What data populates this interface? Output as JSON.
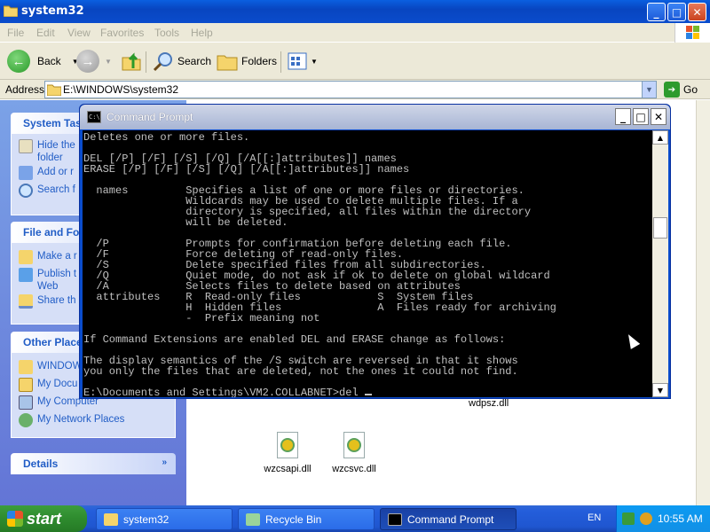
{
  "window": {
    "title": "system32",
    "minimize": "_",
    "maximize": "□",
    "close": "✕"
  },
  "menu": [
    "File",
    "Edit",
    "View",
    "Favorites",
    "Tools",
    "Help"
  ],
  "toolbar": {
    "back_label": "Back",
    "search_label": "Search",
    "folders_label": "Folders"
  },
  "address": {
    "label": "Address",
    "value": "E:\\WINDOWS\\system32",
    "go_label": "Go"
  },
  "left_pane": {
    "system_tasks": {
      "title": "System Tas",
      "items": [
        "Hide the\nfolder",
        "Add or r",
        "Search f"
      ]
    },
    "file_folder": {
      "title": "File and Fol",
      "items": [
        "Make a r",
        "Publish t\nWeb",
        "Share th"
      ]
    },
    "other_places": {
      "title": "Other Place",
      "items": [
        "WINDOW",
        "My Docu",
        "My Computer",
        "My Network Places"
      ]
    },
    "details": {
      "title": "Details"
    }
  },
  "files": [
    {
      "name": "wzcsapi.dll"
    },
    {
      "name": "wzcsvc.dll"
    }
  ],
  "partial_file": "wdpsz.dll",
  "cmd": {
    "title": "Command Prompt",
    "icon_text": "C:\\",
    "lines": [
      "Deletes one or more files.",
      "",
      "DEL [/P] [/F] [/S] [/Q] [/A[[:]attributes]] names",
      "ERASE [/P] [/F] [/S] [/Q] [/A[[:]attributes]] names",
      "",
      "  names         Specifies a list of one or more files or directories.",
      "                Wildcards may be used to delete multiple files. If a",
      "                directory is specified, all files within the directory",
      "                will be deleted.",
      "",
      "  /P            Prompts for confirmation before deleting each file.",
      "  /F            Force deleting of read-only files.",
      "  /S            Delete specified files from all subdirectories.",
      "  /Q            Quiet mode, do not ask if ok to delete on global wildcard",
      "  /A            Selects files to delete based on attributes",
      "  attributes    R  Read-only files            S  System files",
      "                H  Hidden files               A  Files ready for archiving",
      "                -  Prefix meaning not",
      "",
      "If Command Extensions are enabled DEL and ERASE change as follows:",
      "",
      "The display semantics of the /S switch are reversed in that it shows",
      "you only the files that are deleted, not the ones it could not find.",
      "",
      "E:\\Documents and Settings\\VM2.COLLABNET>del "
    ]
  },
  "taskbar": {
    "start_label": "start",
    "tasks": [
      "system32",
      "Recycle Bin",
      "Command Prompt"
    ],
    "lang": "EN",
    "clock": "10:55 AM"
  }
}
